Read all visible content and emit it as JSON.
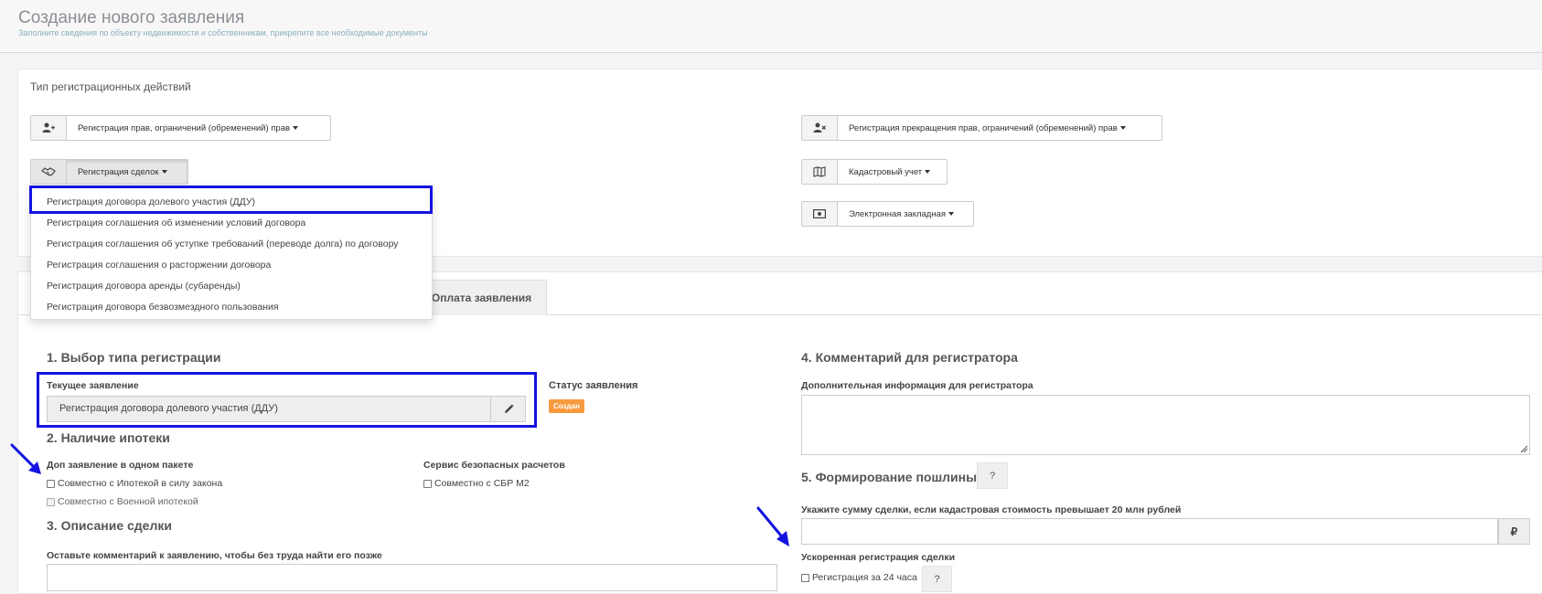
{
  "header": {
    "title": "Создание нового заявления",
    "subtitle": "Заполните сведения по объекту недвижимости и собственникам, прикрепите все необходимые документы"
  },
  "registration_types": {
    "label": "Тип регистрационных действий",
    "buttons": {
      "rights": "Регистрация прав, ограничений (обременений) прав",
      "termination": "Регистрация прекращения прав, ограничений (обременений) прав",
      "deals": "Регистрация сделок",
      "cadastral": "Кадастровый учет",
      "mortgage": "Электронная закладная"
    }
  },
  "dropdown": {
    "items": [
      "Регистрация договора долевого участия (ДДУ)",
      "Регистрация соглашения об изменении условий договора",
      "Регистрация соглашения об уступке требований (переводе долга) по договору",
      "Регистрация соглашения о расторжении договора",
      "Регистрация договора аренды (субаренды)",
      "Регистрация договора безвозмездного пользования"
    ]
  },
  "tabs": {
    "payment": "Оплата заявления"
  },
  "section1": {
    "title": "1. Выбор типа регистрации",
    "current_label": "Текущее заявление",
    "current_value": "Регистрация договора долевого участия (ДДУ)",
    "status_label": "Статус заявления",
    "status_badge": "Создан"
  },
  "section2": {
    "title": "2. Наличие ипотеки",
    "extra_label": "Доп заявление в одном пакете",
    "cb_mortgage_law": "Совместно с Ипотекой в силу закона",
    "cb_military": "Совместно с Военной ипотекой",
    "safe_label": "Сервис безопасных расчетов",
    "cb_sbr": "Совместно с СБР М2"
  },
  "section3": {
    "title": "3. Описание сделки",
    "comment_label": "Оставьте комментарий к заявлению, чтобы без труда найти его позже"
  },
  "section4": {
    "title": "4. Комментарий для регистратора",
    "info_label": "Дополнительная информация для регистратора"
  },
  "section5": {
    "title": "5. Формирование пошлины",
    "help": "?",
    "sum_label": "Укажите сумму сделки, если кадастровая стоимость превышает 20 млн рублей",
    "currency": "₽",
    "fast_label": "Ускоренная регистрация сделки",
    "cb_24h": "Регистрация за 24 часа",
    "help2": "?"
  },
  "colors": {
    "highlight": "#1413e0",
    "badge": "#f79a3e"
  }
}
